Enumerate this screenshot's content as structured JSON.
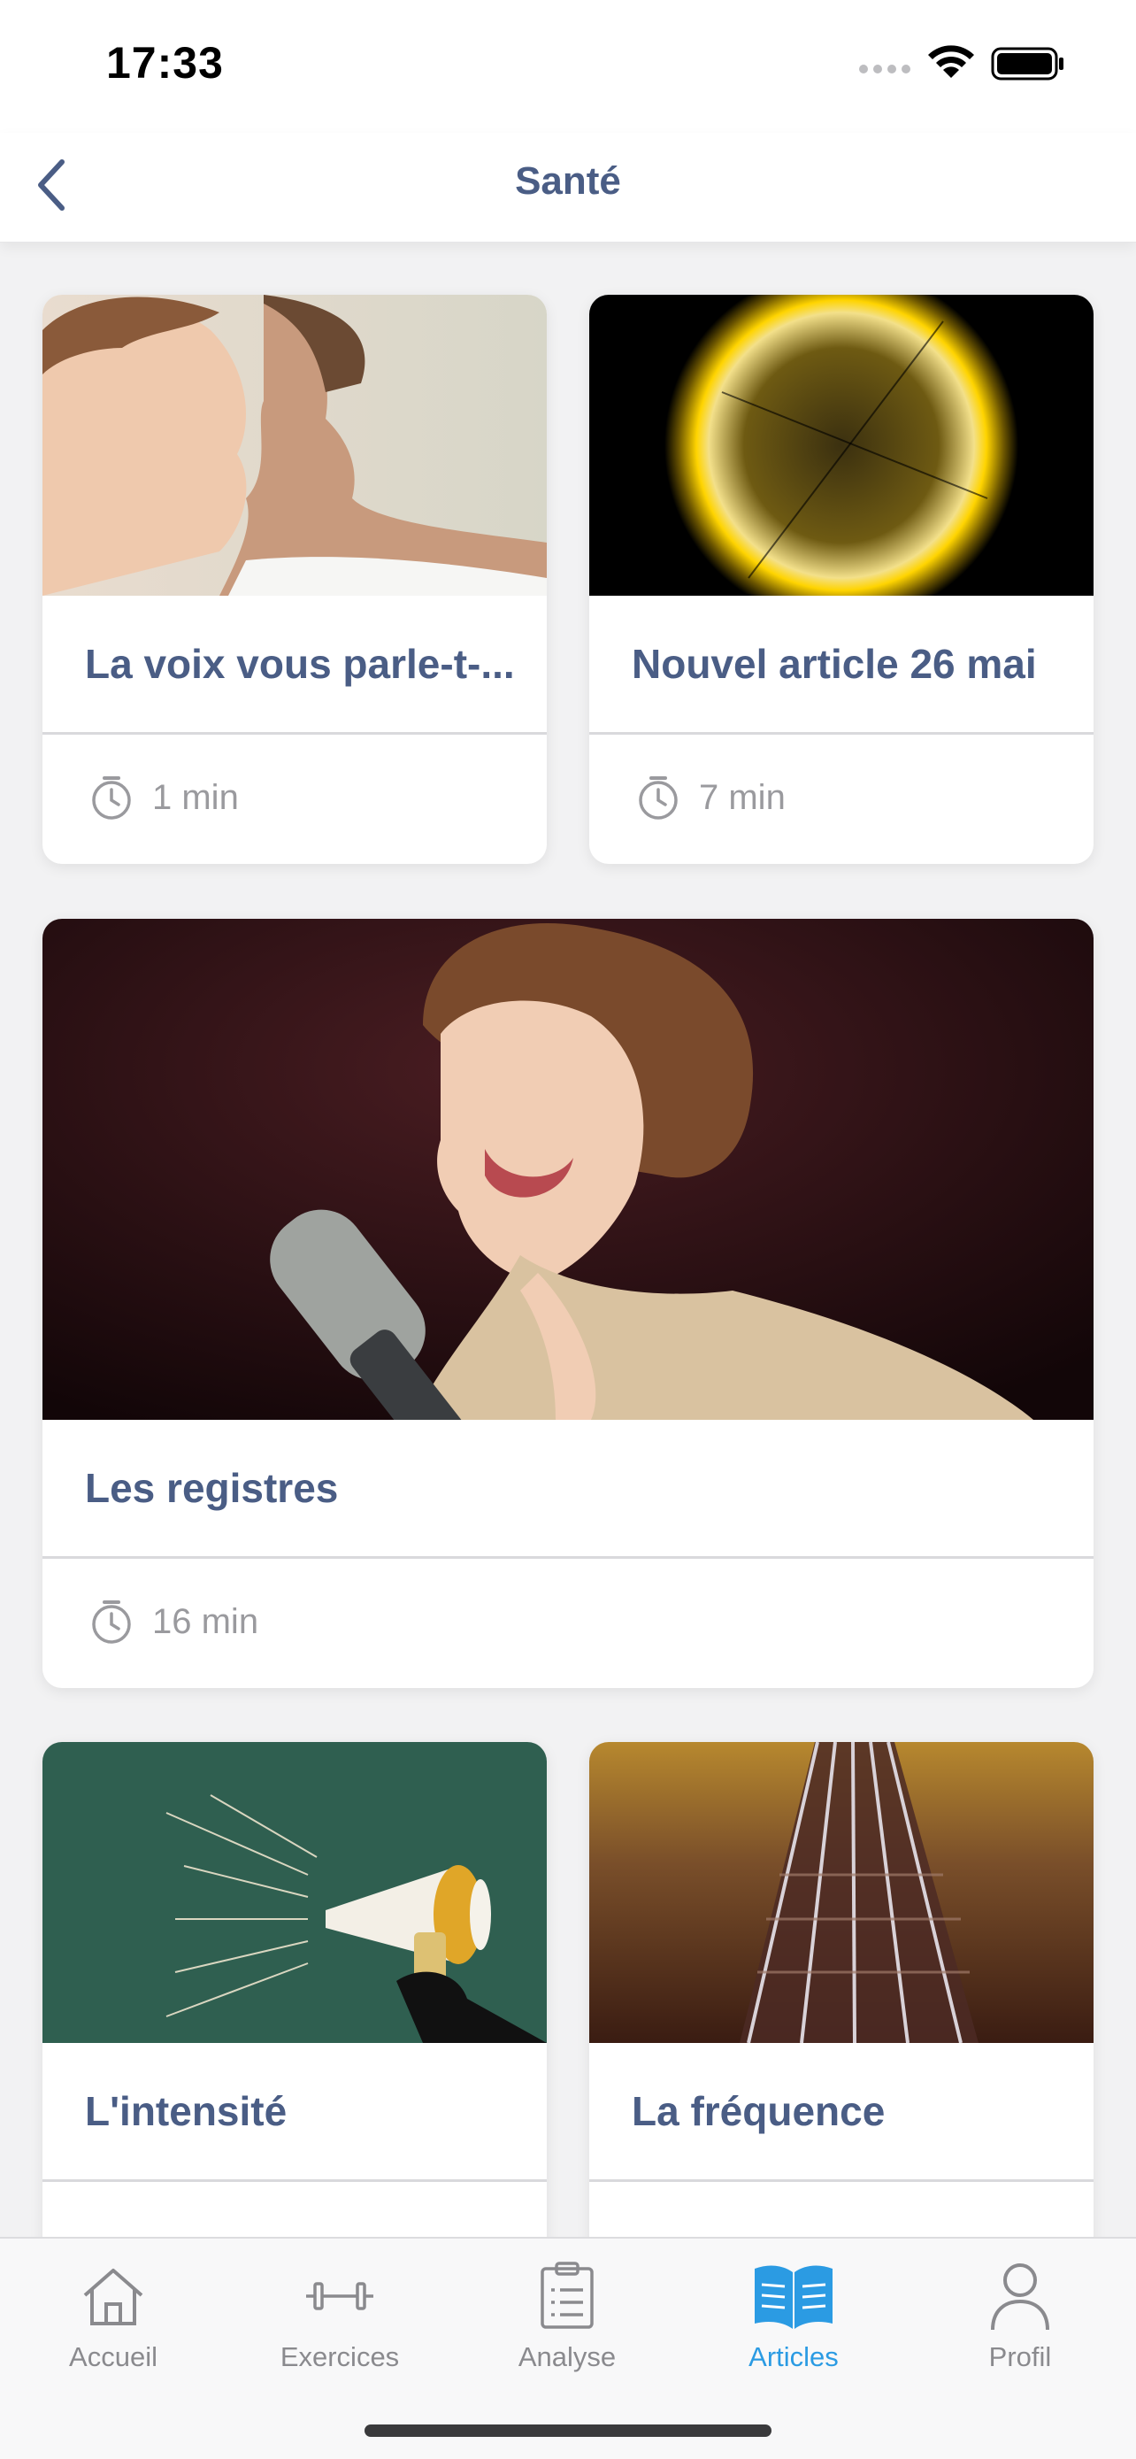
{
  "status": {
    "time": "17:33"
  },
  "nav": {
    "title": "Santé"
  },
  "articles": [
    {
      "title": "La voix vous parle-t-...",
      "duration": "1 min"
    },
    {
      "title": "Nouvel article 26 mai",
      "duration": "7 min"
    },
    {
      "title": "Les registres",
      "duration": "16 min"
    },
    {
      "title": "L'intensité",
      "duration": ""
    },
    {
      "title": "La fréquence",
      "duration": ""
    }
  ],
  "tabs": [
    {
      "label": "Accueil",
      "icon": "home-icon"
    },
    {
      "label": "Exercices",
      "icon": "dumbbell-icon"
    },
    {
      "label": "Analyse",
      "icon": "clipboard-icon"
    },
    {
      "label": "Articles",
      "icon": "book-icon",
      "active": true
    },
    {
      "label": "Profil",
      "icon": "person-icon"
    }
  ],
  "colors": {
    "title": "#4a5d85",
    "active_tab": "#2b9be3",
    "inactive_tab": "#8a8a8e"
  }
}
